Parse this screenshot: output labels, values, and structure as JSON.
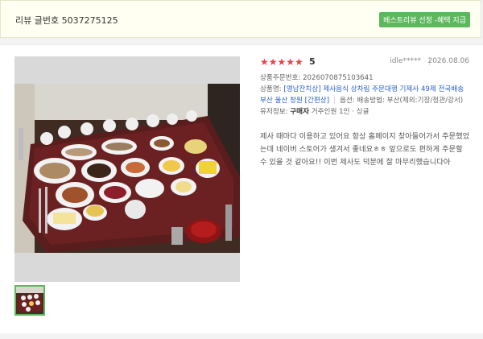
{
  "header": {
    "review_number": "리뷰 글번호 5037275125",
    "best_badge": "베스트리뷰 선정 -혜택 지급"
  },
  "review": {
    "stars": "★★★★★",
    "rating": 5,
    "rating_text": "5",
    "user": "idle*****",
    "date": "2026.08.06",
    "order_label": "상품주문번호: ",
    "order_number": "2026070875103641",
    "product_label": "상품명: ",
    "product_name": "[영남잔치상] 제사음식 상차림 주문대행 기제사 49제 전국배송 부산 울산 창원 [간편상]",
    "option_label": "옵션: ",
    "option_value": "배송방법: 부산(제외:기장/정관/강서)",
    "type_label": "유저정보: ",
    "type_value": "구매자",
    "household": "거주인원 1인 · 싱글",
    "text": "제사 때마다 이용하고 있어요 항상 홈페이지 찾아들어가서 주문했었는데 네이버 스토어가 생겨서 좋네요ㅎㅎ 앞으로도 편하게 주문할 수 있을 것 같아요!! 이번 제사도 덕분에 잘 마무리했습니다아"
  },
  "colors": {
    "badge_green": "#5cb85c",
    "star_red": "#e8404a",
    "link_blue": "#2a5fd1",
    "header_bg": "#fffff2"
  },
  "icons": {
    "photo": "table-food-photo",
    "thumb": "table-food-thumbnail"
  }
}
